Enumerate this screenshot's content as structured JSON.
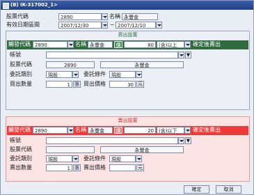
{
  "window": {
    "title": "(B) IK-317002_1>"
  },
  "top": {
    "stock_code_label": "股票代碼",
    "stock_code": "2890",
    "stock_name_label": "名稱",
    "stock_name": "永豐金",
    "date_label": "有效日期區間",
    "date_from": "2007/12/30",
    "date_sep": "~",
    "date_to": "2007/12/10"
  },
  "buy": {
    "section_title": "買出設置",
    "bar": {
      "trigger_code_label": "觸發代碼",
      "trigger_code": "2890",
      "name_label": "名稱",
      "name": "永豐金",
      "badge": "價",
      "price": "80",
      "condition": "(含)以上",
      "action": "確定後賣出"
    },
    "account_label": "帳號",
    "account": "",
    "account_btn": "▼",
    "stock_code_label": "股票代碼",
    "stock_code": "2890",
    "stock_name": "永豐金",
    "order_type_label": "委託類別",
    "order_type": "現股",
    "order_cond_label": "委託條件",
    "order_cond": "現股",
    "qty_label": "買出數量",
    "qty": "1",
    "qty_unit": "張",
    "price_label": "買出價格",
    "price": "30",
    "price_unit": "元"
  },
  "sell": {
    "section_title": "賣出設置",
    "bar": {
      "trigger_code_label": "觸發代碼",
      "trigger_code": "2890",
      "name_label": "名稱",
      "name": "永豐金",
      "badge": "價",
      "price": "20",
      "condition": "(含)以下",
      "action": "確定後賣出"
    },
    "account_label": "帳號",
    "account": "",
    "account_btn": "▼",
    "stock_code_label": "股票代碼",
    "stock_code": "",
    "stock_name": "永豐金",
    "order_type_label": "委託類別",
    "order_type": "現股",
    "order_cond_label": "委託條件",
    "order_cond": "現股",
    "qty_label": "賣出數量",
    "qty": "1",
    "qty_unit": "張",
    "price_label": "賣出價格",
    "price": "",
    "price_unit": "元"
  },
  "footer": {
    "confirm": "確定",
    "cancel": "取消"
  },
  "colors": {
    "buy_bar": "#2f6b3f",
    "sell_bar": "#f03a3a",
    "sell_panel_bg": "#fde4e4"
  }
}
